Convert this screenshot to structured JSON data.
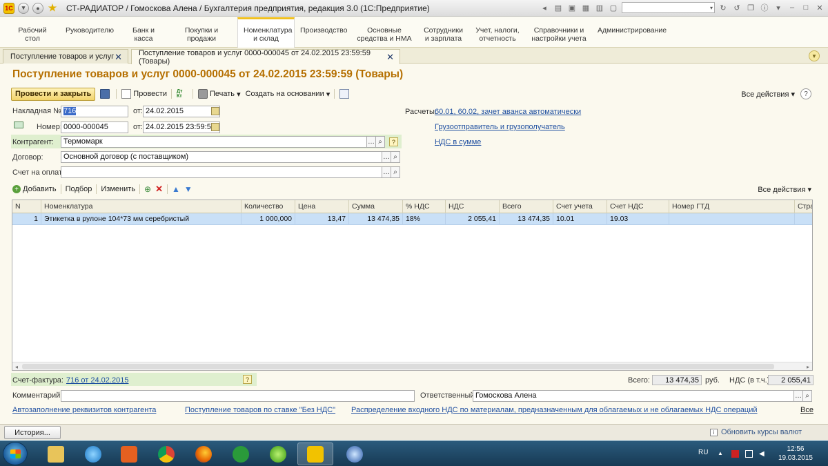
{
  "window": {
    "title": "СТ-РАДИАТОР / Гомоскова Алена / Бухгалтерия предприятия, редакция 3.0 (1С:Предприятие)",
    "logo": "1С"
  },
  "sections": [
    {
      "label": "Рабочий\nстол"
    },
    {
      "label": "Руководителю"
    },
    {
      "label": "Банк и\nкасса"
    },
    {
      "label": "Покупки и\nпродажи"
    },
    {
      "label": "Номенклатура\nи склад",
      "active": true
    },
    {
      "label": "Производство"
    },
    {
      "label": "Основные\nсредства и НМА"
    },
    {
      "label": "Сотрудники\nи зарплата"
    },
    {
      "label": "Учет, налоги,\nотчетность"
    },
    {
      "label": "Справочники и\nнастройки учета"
    },
    {
      "label": "Администрирование"
    }
  ],
  "tabs": [
    {
      "label": "Поступление товаров и услуг"
    },
    {
      "label": "Поступление товаров и услуг 0000-000045 от 24.02.2015 23:59:59 (Товары)",
      "active": true
    }
  ],
  "document": {
    "title": "Поступление товаров и услуг 0000-000045 от 24.02.2015 23:59:59 (Товары)"
  },
  "toolbar": {
    "post_close": "Провести и закрыть",
    "post": "Провести",
    "dtkt_top": "Дт",
    "dtkt_bottom": "Кт",
    "print": "Печать",
    "create_based": "Создать на основании",
    "all_actions": "Все действия"
  },
  "fields": {
    "invoice_no_label": "Накладная №:",
    "invoice_no": "716",
    "from_label": "от:",
    "invoice_date": "24.02.2015",
    "number_label": "Номер:",
    "number": "0000-000045",
    "number_date": "24.02.2015 23:59:59",
    "counterparty_label": "Контрагент:",
    "counterparty": "Термомарк",
    "contract_label": "Договор:",
    "contract": "Основной договор (с поставщиком)",
    "pay_account_label": "Счет на оплату:",
    "pay_account": "",
    "settlements_label": "Расчеты:",
    "settlements_link": "60.01, 60.02, зачет аванса автоматически",
    "shipper_link": "Грузоотправитель и грузополучатель",
    "vat_link": "НДС в сумме"
  },
  "table_toolbar": {
    "add": "Добавить",
    "pick": "Подбор",
    "change": "Изменить",
    "all_actions": "Все действия"
  },
  "table": {
    "columns": [
      "N",
      "Номенклатура",
      "Количество",
      "Цена",
      "Сумма",
      "% НДС",
      "НДС",
      "Всего",
      "Счет учета",
      "Счет НДС",
      "Номер ГТД",
      "Стра"
    ],
    "rows": [
      [
        "1",
        "Этикетка в рулоне 104*73 мм серебристый",
        "1 000,000",
        "13,47",
        "13 474,35",
        "18%",
        "2 055,41",
        "13 474,35",
        "10.01",
        "19.03",
        "",
        ""
      ]
    ]
  },
  "footer": {
    "invoice_label": "Счет-фактура:",
    "invoice_link": "716 от 24.02.2015",
    "total_label": "Всего:",
    "total": "13 474,35",
    "currency": "руб.",
    "vat_label": "НДС (в т.ч.):",
    "vat": "2 055,41",
    "comment_label": "Комментарий:",
    "comment": "",
    "responsible_label": "Ответственный:",
    "responsible": "Гомоскова Алена",
    "link_autofill": "Автозаполнение реквизитов контрагента",
    "link_novat": "Поступление товаров по ставке \"Без НДС\"",
    "link_distribution": "Распределение входного НДС по материалам, предназначенным для облагаемых и не облагаемых НДС операций",
    "link_all": "Все"
  },
  "statusbar": {
    "history": "История...",
    "rates": "Обновить курсы валют"
  },
  "taskbar": {
    "lang": "RU",
    "time": "12:56",
    "date": "19.03.2015",
    "apps": [
      "explorer-icon",
      "ie-icon",
      "media-player-icon",
      "chrome-icon",
      "firefox-icon",
      "mail-agent-icon",
      "icq-icon",
      "1c-icon",
      "thunderbird-icon"
    ]
  }
}
